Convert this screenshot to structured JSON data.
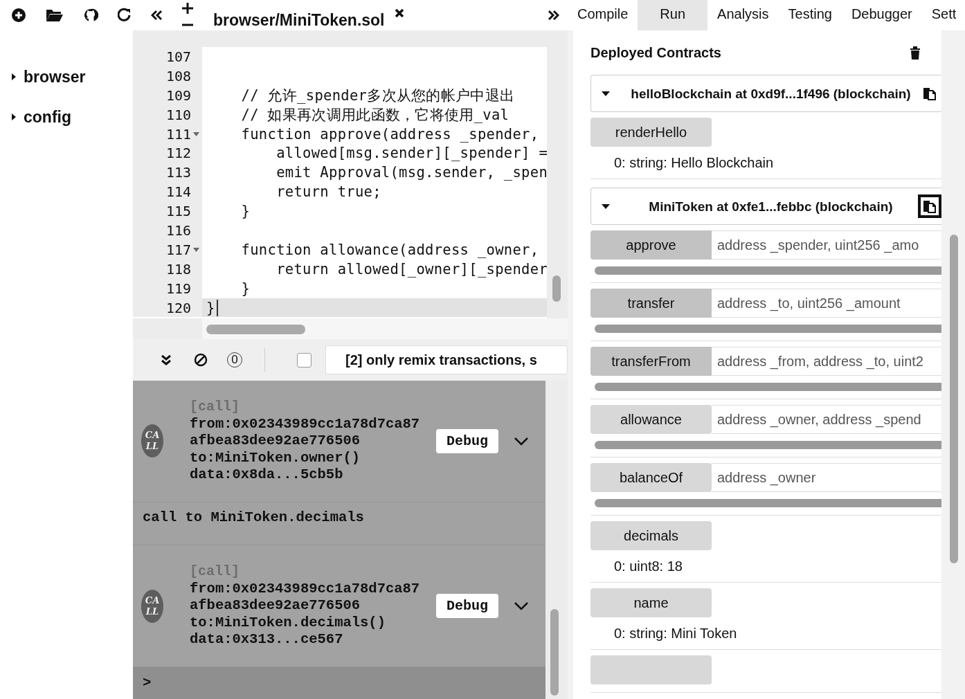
{
  "file_tab": {
    "label": "browser/MiniToken.sol"
  },
  "file_tree": [
    {
      "label": "browser",
      "expanded": false
    },
    {
      "label": "config",
      "expanded": false
    }
  ],
  "editor": {
    "lines": [
      {
        "number": "107"
      },
      {
        "number": "108"
      },
      {
        "number": "109",
        "text": "    // 允许_spender多次从您的帐户中退出"
      },
      {
        "number": "110",
        "text": "    // 如果再次调用此函数，它将使用_val"
      },
      {
        "number": "111",
        "text": "    function approve(address _spender,",
        "foldable": true
      },
      {
        "number": "112",
        "text": "        allowed[msg.sender][_spender] ="
      },
      {
        "number": "113",
        "text": "        emit Approval(msg.sender, _spen"
      },
      {
        "number": "114",
        "text": "        return true;"
      },
      {
        "number": "115",
        "text": "    }"
      },
      {
        "number": "116"
      },
      {
        "number": "117",
        "text": "    function allowance(address _owner,",
        "foldable": true
      },
      {
        "number": "118",
        "text": "        return allowed[_owner][_spender"
      },
      {
        "number": "119",
        "text": "    }"
      },
      {
        "number": "120",
        "text": "}",
        "active": true
      }
    ]
  },
  "terminal": {
    "pending_count": "0",
    "filter": {
      "checked": false,
      "value": "[2] only remix transactions, s"
    },
    "entries": [
      {
        "kind": "call",
        "badge": "CALL",
        "tag": "[call]",
        "from": "from:0x02343989cc1a78d7ca87afbea83dee92ae776506",
        "to": "to:MiniToken.owner()",
        "data": "data:0x8da...5cb5b",
        "button": "Debug"
      },
      {
        "kind": "message",
        "text": "call to MiniToken.decimals"
      },
      {
        "kind": "call",
        "badge": "CALL",
        "tag": "[call]",
        "from": "from:0x02343989cc1a78d7ca87afbea83dee92ae776506",
        "to": "to:MiniToken.decimals()",
        "data": "data:0x313...ce567",
        "button": "Debug"
      }
    ],
    "prompt": ">"
  },
  "right_tabs": [
    {
      "label": "Compile",
      "selected": false
    },
    {
      "label": "Run",
      "selected": true
    },
    {
      "label": "Analysis",
      "selected": false
    },
    {
      "label": "Testing",
      "selected": false
    },
    {
      "label": "Debugger",
      "selected": false
    },
    {
      "label": "Sett",
      "selected": false
    }
  ],
  "run_panel": {
    "title": "Deployed Contracts",
    "contracts": [
      {
        "title": "helloBlockchain at 0xd9f...1f496 (blockchain)",
        "expanded": true,
        "copy_focused": false,
        "functions": [
          {
            "kind": "call",
            "name": "renderHello",
            "output": "0: string: Hello Blockchain"
          }
        ]
      },
      {
        "title": "MiniToken at 0xfe1...febbc (blockchain)",
        "expanded": true,
        "copy_focused": true,
        "functions": [
          {
            "kind": "transact",
            "name": "approve",
            "placeholder": "address _spender, uint256 _amo"
          },
          {
            "kind": "transact",
            "name": "transfer",
            "placeholder": "address _to, uint256 _amount"
          },
          {
            "kind": "transact",
            "name": "transferFrom",
            "placeholder": "address _from, address _to, uint2"
          },
          {
            "kind": "call",
            "name": "allowance",
            "placeholder": "address _owner, address _spend"
          },
          {
            "kind": "call",
            "name": "balanceOf",
            "placeholder": "address _owner"
          },
          {
            "kind": "call",
            "name": "decimals",
            "output": "0: uint8: 18"
          },
          {
            "kind": "call",
            "name": "name",
            "output": "0: string: Mini Token"
          },
          {
            "kind": "call"
          }
        ]
      }
    ]
  }
}
